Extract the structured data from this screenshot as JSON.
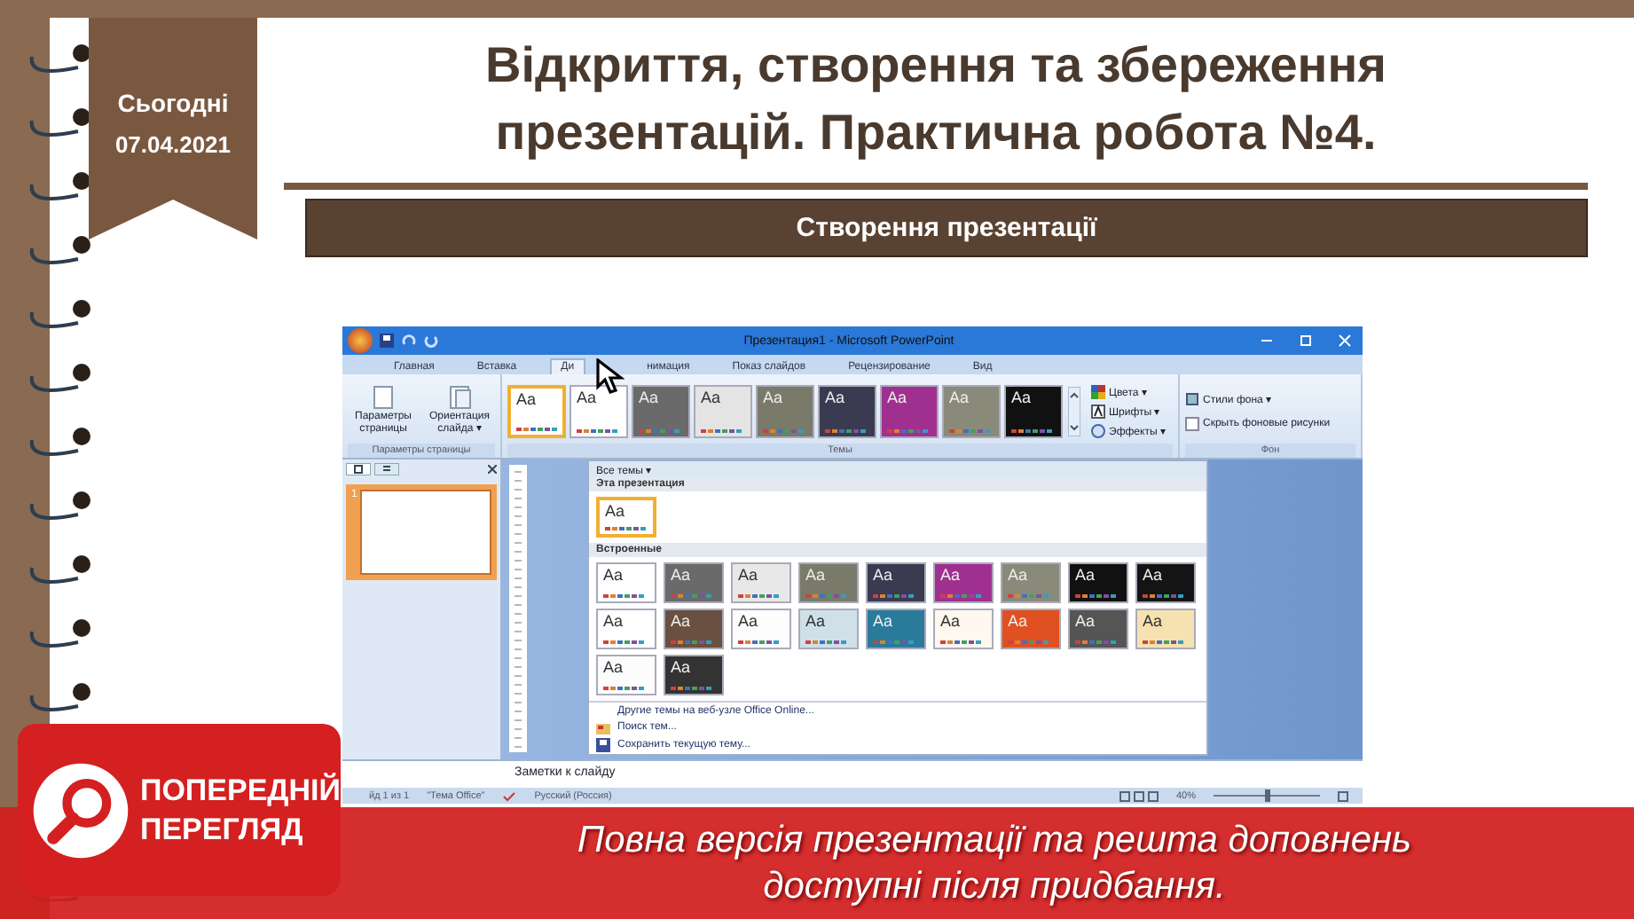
{
  "bookmark": {
    "label": "Сьогодні",
    "date": "07.04.2021"
  },
  "title": "Відкриття, створення та збереження презентацій. Практична робота №4.",
  "section": "Створення презентації",
  "ppt": {
    "title": "Презентация1 - Microsoft PowerPoint",
    "tabs": [
      {
        "label": "Главная",
        "selected": false
      },
      {
        "label": "Вставка",
        "selected": false
      },
      {
        "label": "Ди",
        "selected": true
      },
      {
        "label": "нимация",
        "selected": false
      },
      {
        "label": "Показ слайдов",
        "selected": false
      },
      {
        "label": "Рецензирование",
        "selected": false
      },
      {
        "label": "Вид",
        "selected": false
      }
    ],
    "page_setup": {
      "buttons": [
        "Параметры страницы",
        "Ориентация слайда ▾"
      ],
      "group": "Параметры страницы"
    },
    "themes_group": "Темы",
    "ribbon_themes": [
      {
        "sample": "Aa",
        "color": "#ffffff",
        "selected": true
      },
      {
        "sample": "Aa",
        "color": "#fefefe",
        "selected": false
      },
      {
        "sample": "Aa",
        "color": "#6a6a6a",
        "selected": false
      },
      {
        "sample": "Aa",
        "color": "#e4e4e4",
        "selected": false
      },
      {
        "sample": "Aa",
        "color": "#7a7a6a",
        "selected": false
      },
      {
        "sample": "Aa",
        "color": "#3a3a50",
        "selected": false
      },
      {
        "sample": "Aa",
        "color": "#a03090",
        "selected": false
      },
      {
        "sample": "Aa",
        "color": "#8a8a7a",
        "selected": false
      },
      {
        "sample": "Aa",
        "color": "#111111",
        "selected": false
      }
    ],
    "theme_options": [
      "Цвета ▾",
      "Шрифты ▾",
      "Эффекты ▾"
    ],
    "background": {
      "items": [
        {
          "kind": "dropdown",
          "label": "Стили фона ▾"
        },
        {
          "kind": "checkbox",
          "label": "Скрыть фоновые рисунки",
          "checked": false
        }
      ],
      "group": "Фон"
    },
    "slide_number": "1",
    "gallery": {
      "header": "Все темы ▾",
      "current_label": "Эта презентация",
      "current": [
        {
          "sample": "Aa",
          "color": "#ffffff",
          "selected": true
        }
      ],
      "builtin_label": "Встроенные",
      "builtin": [
        {
          "sample": "Aa",
          "color": "#ffffff",
          "selected": false
        },
        {
          "sample": "Aa",
          "color": "#6a6a6a",
          "selected": false
        },
        {
          "sample": "Aa",
          "color": "#e8e8e8",
          "selected": false
        },
        {
          "sample": "Aa",
          "color": "#7a7a6a",
          "selected": false
        },
        {
          "sample": "Aa",
          "color": "#3a3a50",
          "selected": false
        },
        {
          "sample": "Aa",
          "color": "#a03090",
          "selected": false
        },
        {
          "sample": "Aa",
          "color": "#8a8a7a",
          "selected": false
        },
        {
          "sample": "Aa",
          "color": "#111111",
          "selected": false
        },
        {
          "sample": "Aa",
          "color": "#141414",
          "selected": false
        },
        {
          "sample": "Aa",
          "color": "#fefefe",
          "selected": false
        },
        {
          "sample": "Aa",
          "color": "#6a5040",
          "selected": false
        },
        {
          "sample": "Aa",
          "color": "#fdfdfd",
          "selected": false
        },
        {
          "sample": "Aa",
          "color": "#cfe0e8",
          "selected": false
        },
        {
          "sample": "Aa",
          "color": "#2a7a9a",
          "selected": false
        },
        {
          "sample": "Aa",
          "color": "#fff8ee",
          "selected": false
        },
        {
          "sample": "Aa",
          "color": "#e05020",
          "selected": false
        },
        {
          "sample": "Aa",
          "color": "#555555",
          "selected": false
        },
        {
          "sample": "Aa",
          "color": "#f5e2b0",
          "selected": false
        },
        {
          "sample": "Aa",
          "color": "#fcfcfc",
          "selected": false
        },
        {
          "sample": "Aa",
          "color": "#333333",
          "selected": false
        }
      ],
      "menu": [
        {
          "kind": "link",
          "label": "Другие темы на веб-узле Office Online..."
        },
        {
          "kind": "search",
          "label": "Поиск тем..."
        },
        {
          "kind": "save",
          "label": "Сохранить текущую тему..."
        }
      ]
    },
    "notes": "Заметки к слайду",
    "status": {
      "slide": "йд 1 из 1",
      "theme": "\"Тема Office\"",
      "language": "Русский (Россия)",
      "zoom": "40%",
      "zoom_slider": {
        "level": 0.5
      }
    }
  },
  "banner": {
    "badge": [
      "ПОПЕРЕДНІЙ",
      "ПЕРЕГЛЯД"
    ],
    "lines": [
      "Повна версія презентації та решта доповнень",
      "доступні після придбання."
    ]
  }
}
